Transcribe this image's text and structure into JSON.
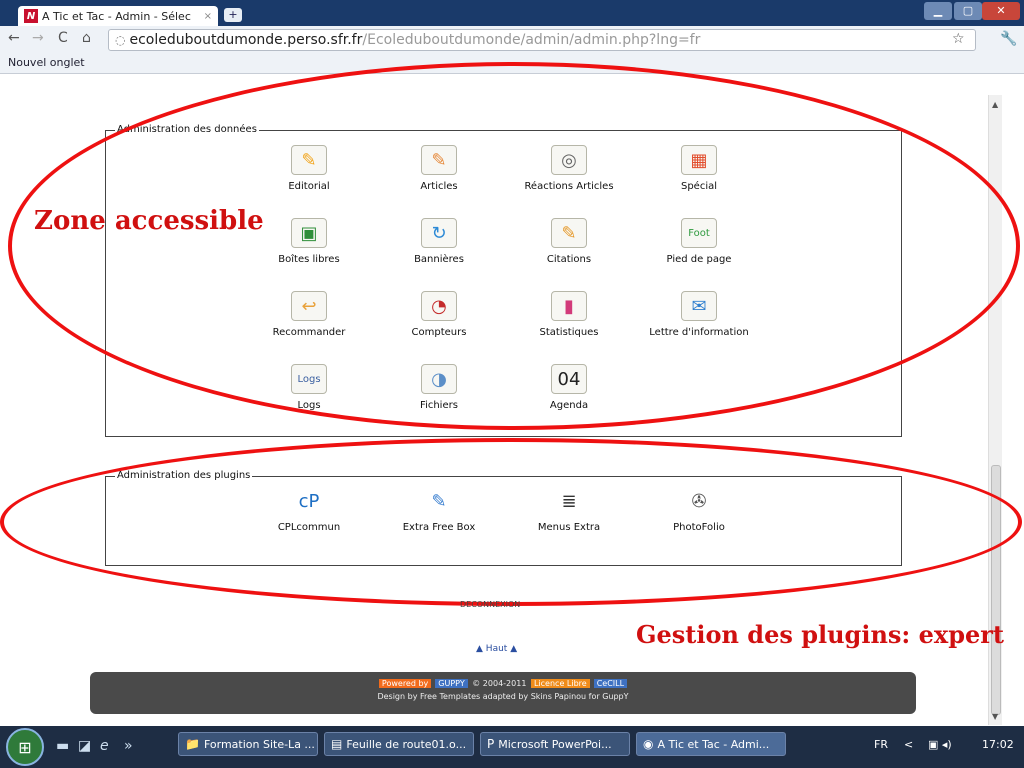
{
  "browser": {
    "tab_title": "A Tic et Tac - Admin - Sélec",
    "tab_favicon": "N",
    "tab_close": "×",
    "newtab": "+",
    "window_min": "▁",
    "window_max": "▢",
    "window_close": "✕",
    "url_host": "ecoleduboutdumonde.perso.sfr.fr",
    "url_path": "/Ecoleduboutdumonde/admin/admin.php?lng=fr",
    "bookmark": "Nouvel onglet",
    "icons": {
      "back": "←",
      "forward": "→",
      "reload": "C",
      "home": "⌂",
      "globe": "◌",
      "star": "☆",
      "wrench": "🔧"
    }
  },
  "data_admin": {
    "legend": "Administration des données",
    "items": [
      {
        "label": "Editorial",
        "icon": "✎",
        "color": "#f2a51c"
      },
      {
        "label": "Articles",
        "icon": "✎",
        "color": "#e6893a"
      },
      {
        "label": "Réactions Articles",
        "icon": "◎",
        "color": "#666666"
      },
      {
        "label": "Spécial",
        "icon": "▦",
        "color": "#e24d2c"
      },
      {
        "label": "Boîtes libres",
        "icon": "▣",
        "color": "#2f8f3a"
      },
      {
        "label": "Bannières",
        "icon": "↻",
        "color": "#2d8ad6"
      },
      {
        "label": "Citations",
        "icon": "✎",
        "color": "#e69a2c"
      },
      {
        "label": "Pied de page",
        "icon": "Foot",
        "color": "#2e9a3e"
      },
      {
        "label": "Recommander",
        "icon": "↩",
        "color": "#e9a23b"
      },
      {
        "label": "Compteurs",
        "icon": "◔",
        "color": "#c42b2b"
      },
      {
        "label": "Statistiques",
        "icon": "▮",
        "color": "#d23a7a"
      },
      {
        "label": "Lettre d'information",
        "icon": "✉",
        "color": "#2f7fcf"
      },
      {
        "label": "Logs",
        "icon": "Logs",
        "color": "#3a5fa0"
      },
      {
        "label": "Fichiers",
        "icon": "◑",
        "color": "#5c8fc8"
      },
      {
        "label": "Agenda",
        "icon": "04",
        "color": "#222222"
      }
    ]
  },
  "plugins_admin": {
    "legend": "Administration des plugins",
    "items": [
      {
        "label": "CPLcommun",
        "icon": "cP",
        "color": "#1e6fc4"
      },
      {
        "label": "Extra Free Box",
        "icon": "✎",
        "color": "#3a7fd0"
      },
      {
        "label": "Menus Extra",
        "icon": "≣",
        "color": "#333333"
      },
      {
        "label": "PhotoFolio",
        "icon": "✇",
        "color": "#555555"
      }
    ]
  },
  "annotations": {
    "zone_accessible": "Zone accessible",
    "gestion_plugins": "Gestion des plugins: expert",
    "oval_color": "#e11111"
  },
  "page": {
    "deconnexion": "DECONNEXION",
    "haut": "Haut",
    "haut_arrow_left": "▲",
    "haut_arrow_right": "▲",
    "footer": {
      "powered_by": "Powered by",
      "guppy": "GUPPY",
      "copyright": "© 2004-2011",
      "licence": "Licence Libre",
      "cecill": "CeCILL",
      "design": "Design by Free Templates adapted by Skins Papinou for GuppY"
    }
  },
  "taskbar": {
    "start_icon": "⊞",
    "quicklaunch": [
      "▬",
      "◪",
      "e",
      "»"
    ],
    "buttons": [
      {
        "label": "Formation Site-La ...",
        "icon": "📁"
      },
      {
        "label": "Feuille de route01.o...",
        "icon": "▤"
      },
      {
        "label": "Microsoft PowerPoi...",
        "icon": "P"
      },
      {
        "label": "A Tic et Tac - Admi...",
        "icon": "◉"
      }
    ],
    "lang": "FR",
    "chevron": "<",
    "tray_icons": "▣ ◂)",
    "clock": "17:02"
  }
}
